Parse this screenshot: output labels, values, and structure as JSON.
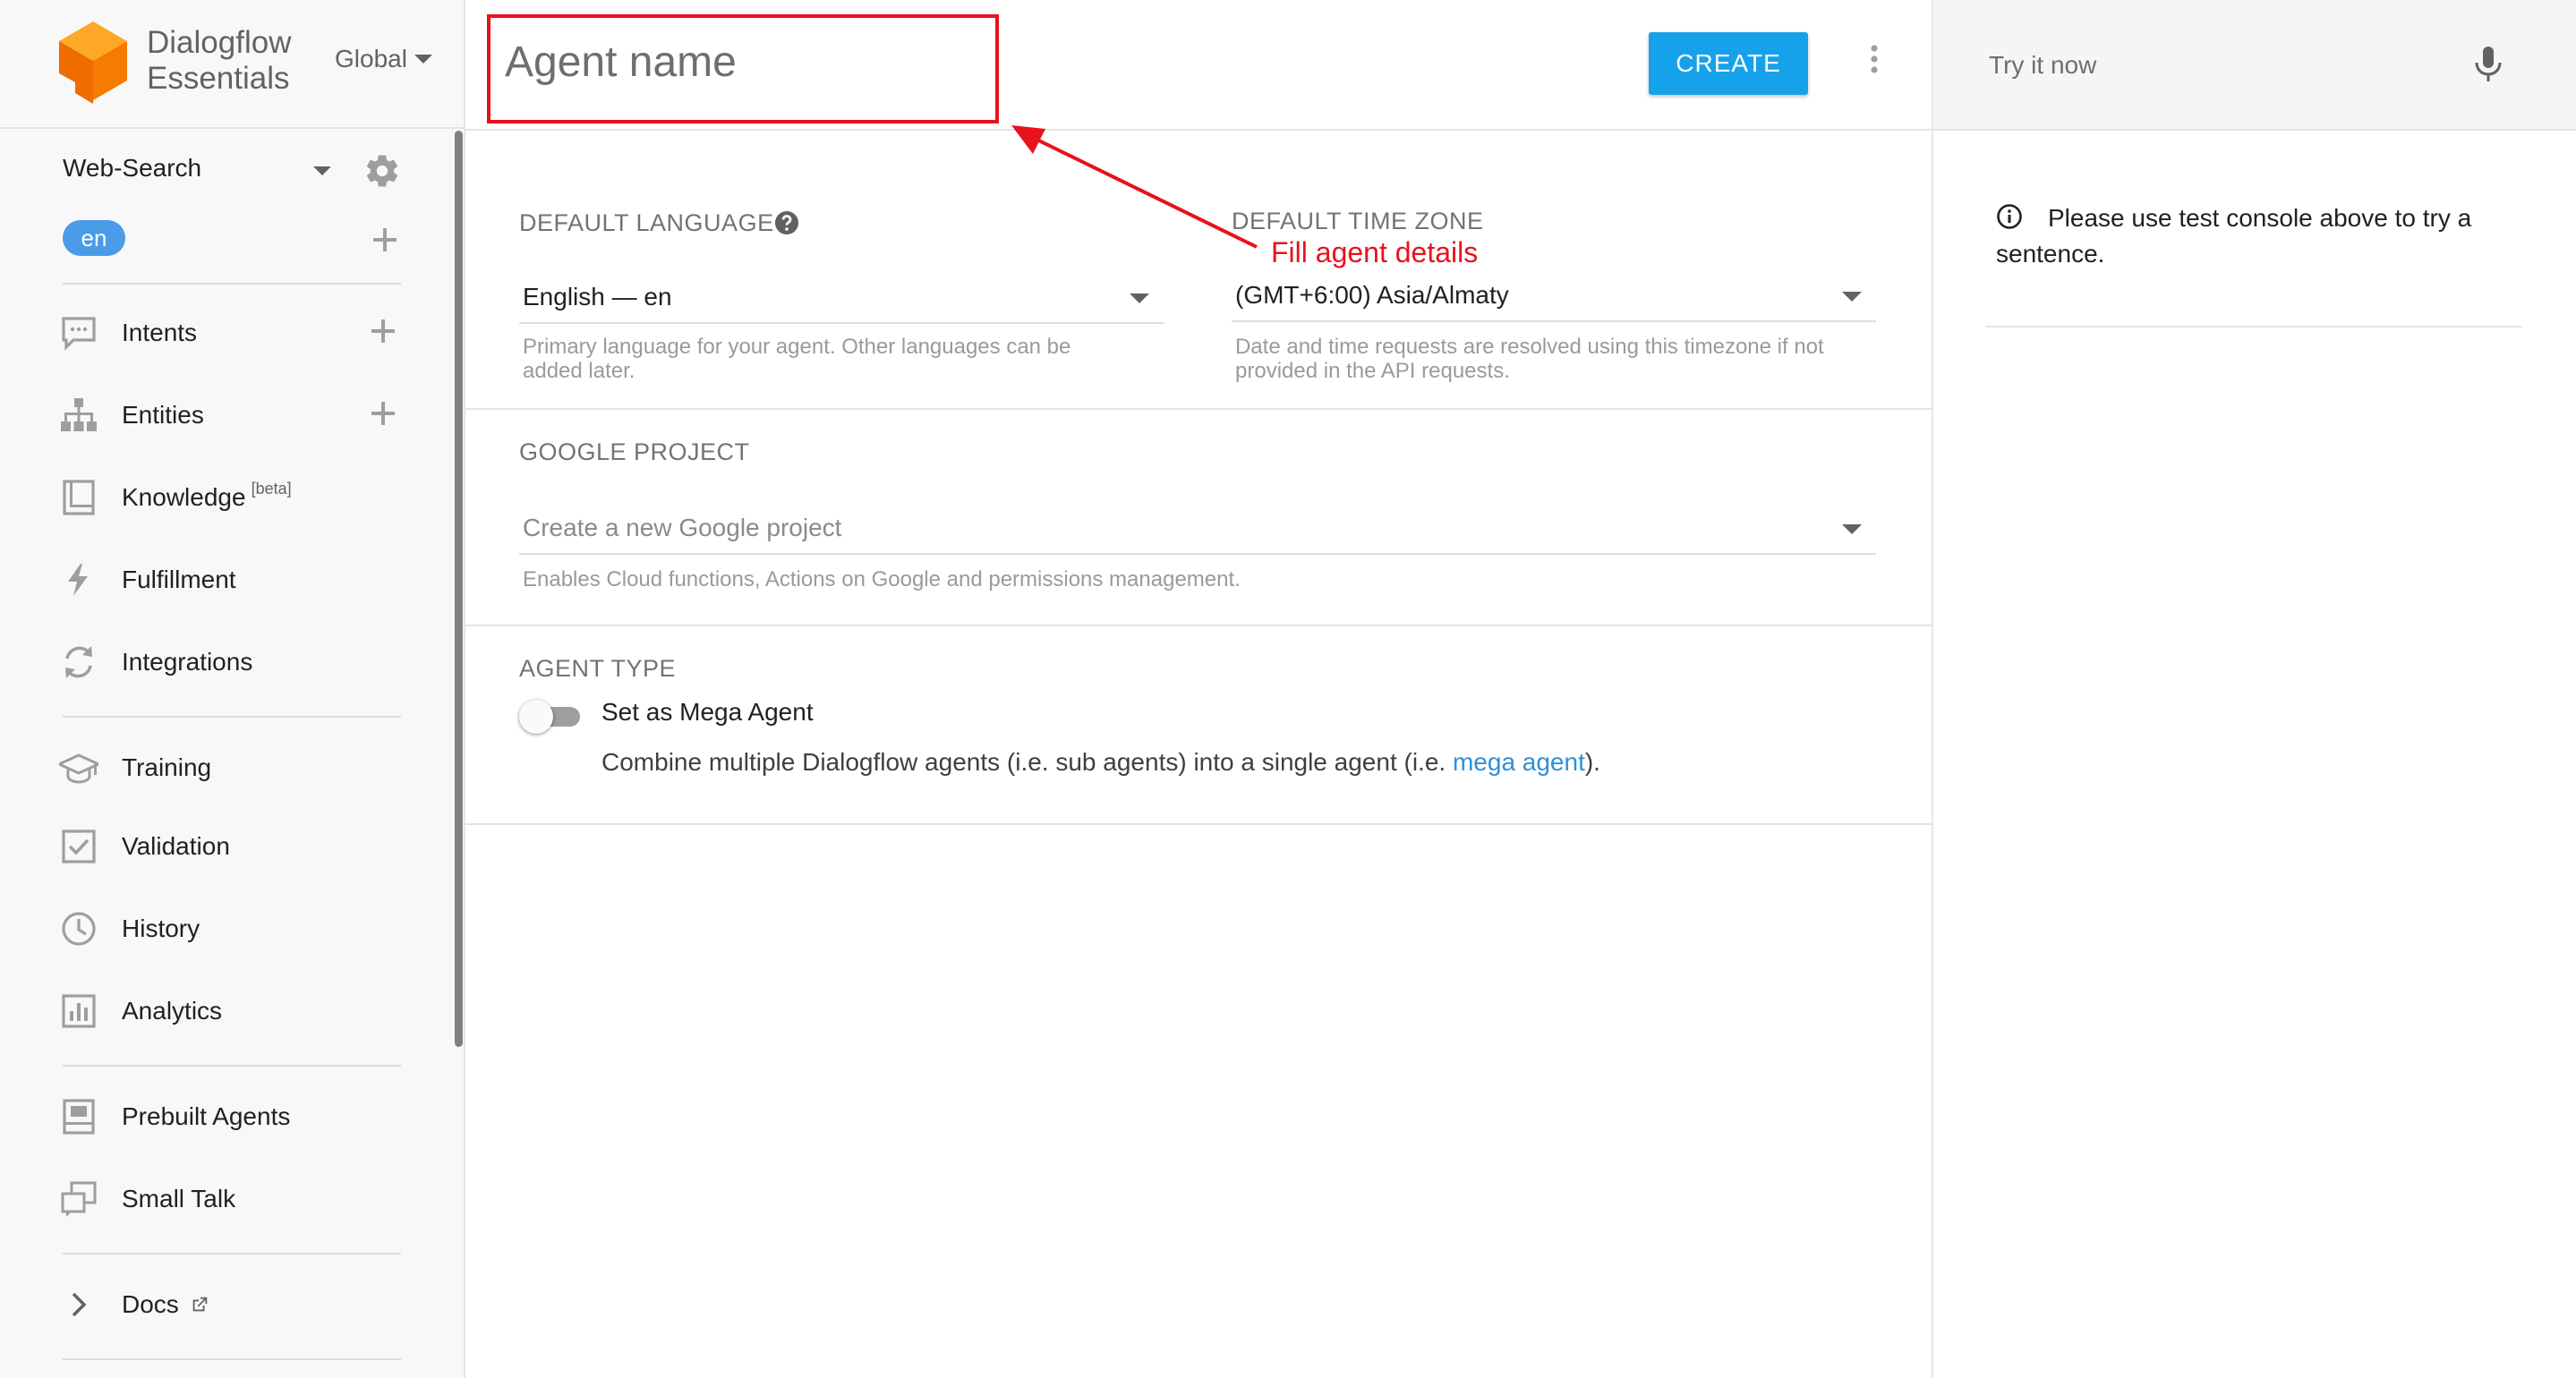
{
  "sidebar": {
    "brand_line1": "Dialogflow",
    "brand_line2": "Essentials",
    "region": "Global",
    "agent": "Web-Search",
    "language_chip": "en",
    "nav": {
      "intents": "Intents",
      "entities": "Entities",
      "knowledge": "Knowledge",
      "knowledge_badge": "[beta]",
      "fulfillment": "Fulfillment",
      "integrations": "Integrations",
      "training": "Training",
      "validation": "Validation",
      "history": "History",
      "analytics": "Analytics",
      "prebuilt_agents": "Prebuilt Agents",
      "small_talk": "Small Talk",
      "docs": "Docs"
    }
  },
  "header": {
    "agent_name_placeholder": "Agent name",
    "create_label": "CREATE"
  },
  "form": {
    "default_language_label": "DEFAULT LANGUAGE",
    "default_language_value": "English — en",
    "default_language_hint": "Primary language for your agent. Other languages can be added later.",
    "time_zone_label": "DEFAULT TIME ZONE",
    "time_zone_value": "(GMT+6:00) Asia/Almaty",
    "time_zone_hint": "Date and time requests are resolved using this timezone if not provided in the API requests.",
    "google_project_label": "GOOGLE PROJECT",
    "google_project_placeholder": "Create a new Google project",
    "google_project_hint": "Enables Cloud functions, Actions on Google and permissions management.",
    "agent_type_label": "AGENT TYPE",
    "mega_agent_label": "Set as Mega Agent",
    "mega_agent_enabled": false,
    "mega_agent_desc_before": "Combine multiple Dialogflow agents (i.e. sub agents) into a single agent (i.e. ",
    "mega_agent_link": "mega agent",
    "mega_agent_desc_after": ")."
  },
  "annotation": {
    "text": "Fill agent details",
    "color": "#e8121c"
  },
  "right_panel": {
    "try_placeholder": "Try it now",
    "info_text": "Please use test console above to try a sentence."
  },
  "colors": {
    "accent": "#16a2ea",
    "chip": "#4a9be8",
    "link": "#2e8fd8",
    "logo_orange": "#f57c00"
  }
}
